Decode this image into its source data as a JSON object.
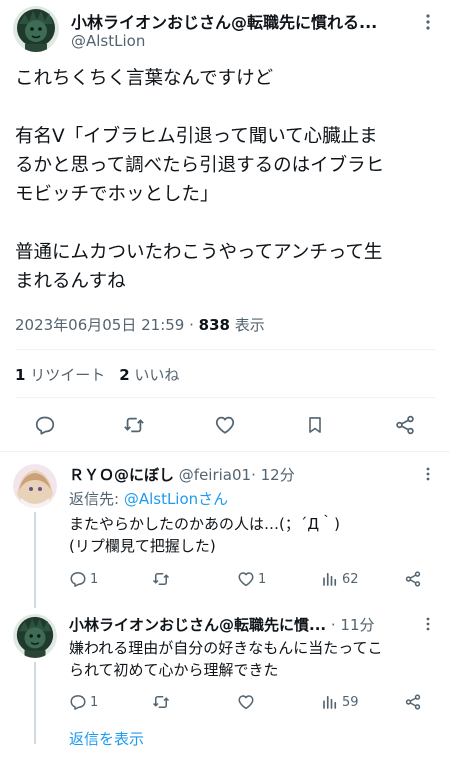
{
  "main_tweet": {
    "author_name": "小林ライオンおじさん@転職先に慣れる...",
    "handle": "@AlstLion",
    "body_lines": [
      "これちくちく言葉なんですけど",
      "",
      "有名V「イブラヒム引退って聞いて心臓止ま",
      "るかと思って調べたら引退するのはイブラヒ",
      "モビッチでホッとした」",
      "",
      "普通にムカついたわこうやってアンチって生",
      "まれるんすね"
    ],
    "timestamp": "2023年06月05日 21:59",
    "separator": " · ",
    "views_count": "838",
    "views_label": " 表示",
    "retweets_count": "1",
    "retweets_label": " リツイート",
    "likes_count": "2",
    "likes_label": " いいね"
  },
  "replies": [
    {
      "author_name": "ＲＹＯ@にぼし",
      "handle": "@feiria01",
      "time": "· 12分",
      "reply_to_prefix": "返信先: ",
      "reply_to_handle": "@AlstLion",
      "reply_to_suffix": "さん",
      "text_lines": [
        "またやらかしたのかあの人は…(；´Д｀)",
        "(リプ欄見て把握した)"
      ],
      "reply_count": "1",
      "retweet_count": "",
      "like_count": "1",
      "view_count": "62"
    },
    {
      "author_name": "小林ライオンおじさん@転職先に慣...",
      "handle": "",
      "time": "· 11分",
      "text_lines": [
        "嫌われる理由が自分の好きなもんに当たってこ",
        "られて初めて心から理解できた"
      ],
      "reply_count": "1",
      "retweet_count": "",
      "like_count": "",
      "view_count": "59"
    }
  ],
  "show_replies": "返信を表示",
  "colors": {
    "text": "#0f1419",
    "secondary": "#536471",
    "link": "#1d9bf0",
    "divider": "#eff3f4"
  }
}
